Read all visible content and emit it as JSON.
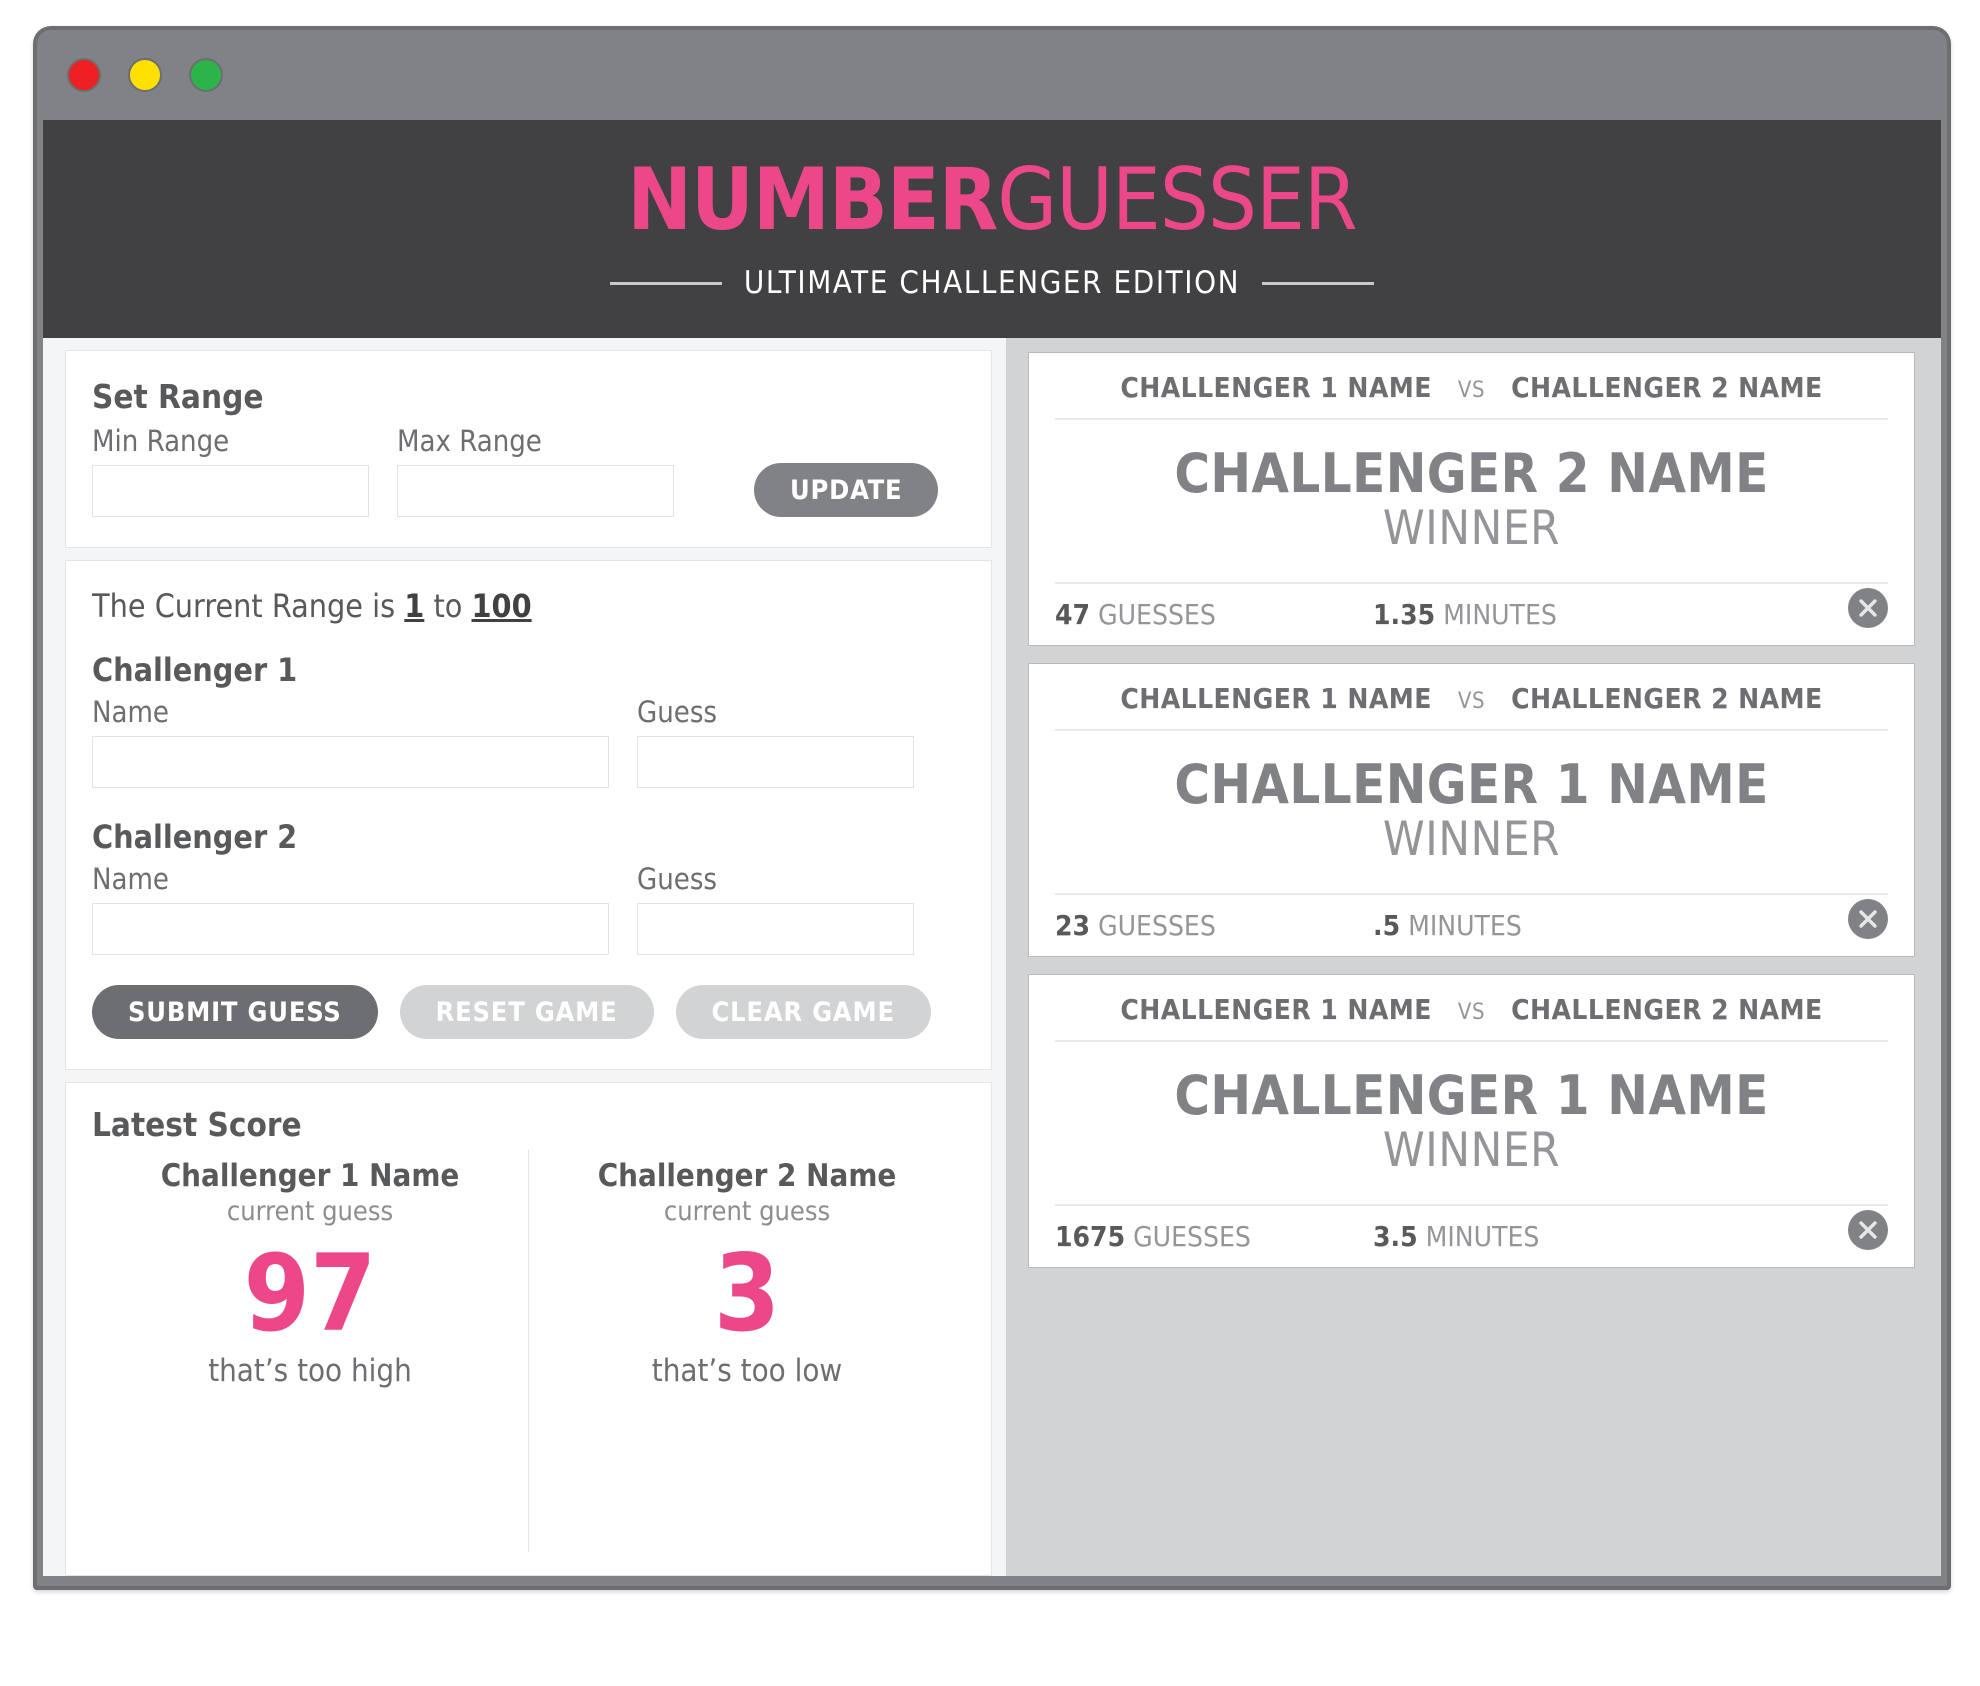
{
  "window": {
    "dots": [
      {
        "name": "close",
        "color": "#ed2024"
      },
      {
        "name": "minimize",
        "color": "#ffe000"
      },
      {
        "name": "maximize",
        "color": "#2cb34a"
      }
    ]
  },
  "header": {
    "logo_bold": "NUMBER",
    "logo_light": "GUESSER",
    "subtitle": "ULTIMATE CHALLENGER EDITION"
  },
  "set_range": {
    "title": "Set Range",
    "min_label": "Min Range",
    "min_value": "",
    "min_placeholder": "",
    "max_label": "Max Range",
    "max_value": "",
    "max_placeholder": "",
    "update_label": "UPDATE"
  },
  "game": {
    "range_prefix": "The Current Range is ",
    "range_min": "1",
    "range_joiner": " to ",
    "range_max": "100",
    "challenger1": {
      "title": "Challenger 1",
      "name_label": "Name",
      "name_value": "",
      "guess_label": "Guess",
      "guess_value": ""
    },
    "challenger2": {
      "title": "Challenger 2",
      "name_label": "Name",
      "name_value": "",
      "guess_label": "Guess",
      "guess_value": ""
    },
    "submit_label": "SUBMIT GUESS",
    "reset_label": "RESET GAME",
    "clear_label": "CLEAR GAME"
  },
  "latest_score": {
    "title": "Latest Score",
    "columns": [
      {
        "name": "Challenger 1 Name",
        "caption": "current guess",
        "value": "97",
        "hint": "that’s too high"
      },
      {
        "name": "Challenger 2 Name",
        "caption": "current guess",
        "value": "3",
        "hint": "that’s too low"
      }
    ]
  },
  "past_games": {
    "vs_label": "VS",
    "winner_label": "WINNER",
    "guesses_label": "GUESSES",
    "minutes_label": "MINUTES",
    "cards": [
      {
        "player1": "CHALLENGER 1 NAME",
        "player2": "CHALLENGER 2 NAME",
        "winner": "CHALLENGER 2 NAME",
        "guesses": "47",
        "minutes": "1.35"
      },
      {
        "player1": "CHALLENGER 1 NAME",
        "player2": "CHALLENGER 2 NAME",
        "winner": "CHALLENGER 1 NAME",
        "guesses": "23",
        "minutes": ".5"
      },
      {
        "player1": "CHALLENGER 1 NAME",
        "player2": "CHALLENGER 2 NAME",
        "winner": "CHALLENGER 1 NAME",
        "guesses": "1675",
        "minutes": "3.5"
      }
    ]
  },
  "colors": {
    "accent_pink": "#ec4889",
    "header_dark": "#414042",
    "panel_gray": "#d1d3d4",
    "text_gray": "#58595b"
  }
}
